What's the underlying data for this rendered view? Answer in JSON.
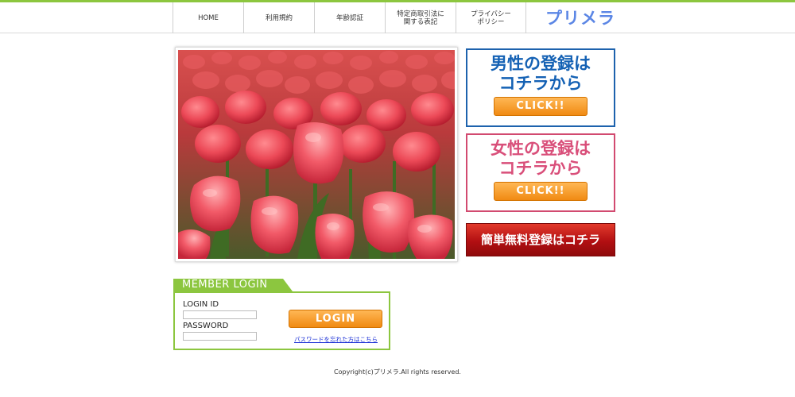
{
  "header": {
    "nav": [
      {
        "label": "HOME"
      },
      {
        "label": "利用規約"
      },
      {
        "label": "年齢認証"
      },
      {
        "label": "特定商取引法に\n関する表記"
      },
      {
        "label": "プライバシー\nポリシー"
      }
    ],
    "logo": "プリメラ"
  },
  "registration": {
    "male_title_line1": "男性の登録は",
    "male_title_line2": "コチラから",
    "male_click": "CLICK!!",
    "female_title_line1": "女性の登録は",
    "female_title_line2": "コチラから",
    "female_click": "CLICK!!",
    "free_label": "簡単無料登録はコチラ"
  },
  "login": {
    "tab_label": "MEMBER LOGIN",
    "id_label": "LOGIN ID",
    "password_label": "PASSWORD",
    "id_value": "",
    "password_value": "",
    "button_label": "LOGIN",
    "forgot_link": "パスワードを忘れた方はこちら"
  },
  "footer": {
    "copyright": "Copyright(c)プリメラ.All rights reserved."
  },
  "colors": {
    "accent_green": "#8cc63f",
    "male_blue": "#1461b4",
    "female_pink": "#d94f7a",
    "orange_button": "#f08a12",
    "free_red": "#b20f12",
    "logo_blue": "#5b86e5"
  }
}
